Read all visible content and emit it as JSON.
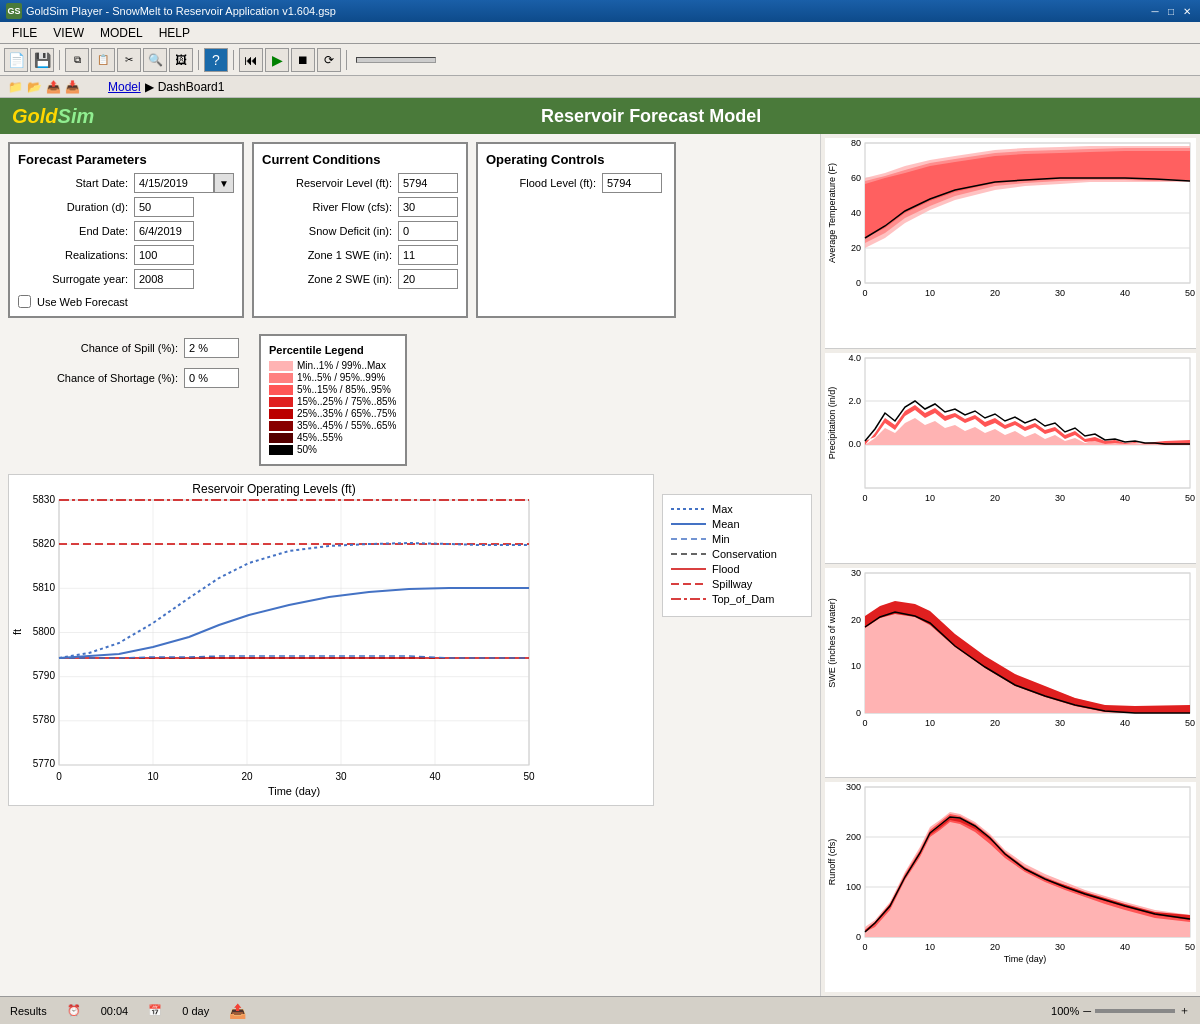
{
  "window": {
    "title": "GoldSim Player - SnowMelt to Reservoir Application v1.604.gsp",
    "icon": "GS"
  },
  "menu": {
    "items": [
      "FILE",
      "VIEW",
      "MODEL",
      "HELP"
    ]
  },
  "breadcrumb": {
    "root": "Model",
    "separator": "▶",
    "current": "DashBoard1"
  },
  "header": {
    "logo": "GoldSim",
    "title": "Reservoir Forecast Model"
  },
  "forecast_params": {
    "title": "Forecast Parameters",
    "start_date_label": "Start Date:",
    "start_date_value": "4/15/2019",
    "duration_label": "Duration (d):",
    "duration_value": "50",
    "end_date_label": "End Date:",
    "end_date_value": "6/4/2019",
    "realizations_label": "Realizations:",
    "realizations_value": "100",
    "surrogate_label": "Surrogate year:",
    "surrogate_value": "2008",
    "web_forecast_label": "Use Web Forecast"
  },
  "current_conditions": {
    "title": "Current Conditions",
    "fields": [
      {
        "label": "Reservoir Level (ft):",
        "value": "5794"
      },
      {
        "label": "River Flow (cfs):",
        "value": "30"
      },
      {
        "label": "Snow Deficit (in):",
        "value": "0"
      },
      {
        "label": "Zone 1 SWE (in):",
        "value": "11"
      },
      {
        "label": "Zone 2 SWE (in):",
        "value": "20"
      }
    ]
  },
  "operating_controls": {
    "title": "Operating Controls",
    "flood_level_label": "Flood Level (ft):",
    "flood_level_value": "5794"
  },
  "chance_values": {
    "spill_label": "Chance of Spill (%):",
    "spill_value": "2 %",
    "shortage_label": "Chance of Shortage (%):",
    "shortage_value": "0 %"
  },
  "percentile_legend": {
    "title": "Percentile Legend",
    "items": [
      {
        "label": "Min..1% / 99%..Max",
        "color": "#ffb3b3"
      },
      {
        "label": "1%..5% / 95%..99%",
        "color": "#ff8080"
      },
      {
        "label": "5%..15% / 85%..95%",
        "color": "#ff5555"
      },
      {
        "label": "15%..25% / 75%..85%",
        "color": "#e02020"
      },
      {
        "label": "25%..35% / 65%..75%",
        "color": "#bb0000"
      },
      {
        "label": "35%..45% / 55%..65%",
        "color": "#880000"
      },
      {
        "label": "45%..55%",
        "color": "#550000"
      },
      {
        "label": "50%",
        "color": "#000000"
      }
    ]
  },
  "reservoir_chart": {
    "title": "Reservoir Operating Levels (ft)",
    "x_label": "Time (day)",
    "y_min": 5770,
    "y_max": 5830,
    "x_min": 0,
    "x_max": 50
  },
  "chart_legend": {
    "items": [
      {
        "label": "Max",
        "style": "dotted-blue"
      },
      {
        "label": "Mean",
        "style": "solid-blue"
      },
      {
        "label": "Min",
        "style": "dashed-blue"
      },
      {
        "label": "Conservation",
        "style": "dashed-black"
      },
      {
        "label": "Flood",
        "style": "solid-red"
      },
      {
        "label": "Spillway",
        "style": "dashed-red"
      },
      {
        "label": "Top_of_Dam",
        "style": "dashdot-red"
      }
    ]
  },
  "side_charts": [
    {
      "title": "Average Temperature (F)",
      "y_label": "Average Temperature (F)",
      "y_max": 80,
      "y_min": 0
    },
    {
      "title": "Precipitation (in/d)",
      "y_label": "Precipitation (in/d)",
      "y_max": 4.0,
      "y_min": 0.0
    },
    {
      "title": "SWE (inches of water)",
      "y_label": "SWE (inches of water)",
      "y_max": 30,
      "y_min": 0
    },
    {
      "title": "Runoff (cfs)",
      "y_label": "Runoff (cfs)",
      "y_max": 300,
      "y_min": 0
    }
  ],
  "status_bar": {
    "status": "Results",
    "time1": "00:04",
    "time2": "0 day",
    "zoom": "100%"
  }
}
